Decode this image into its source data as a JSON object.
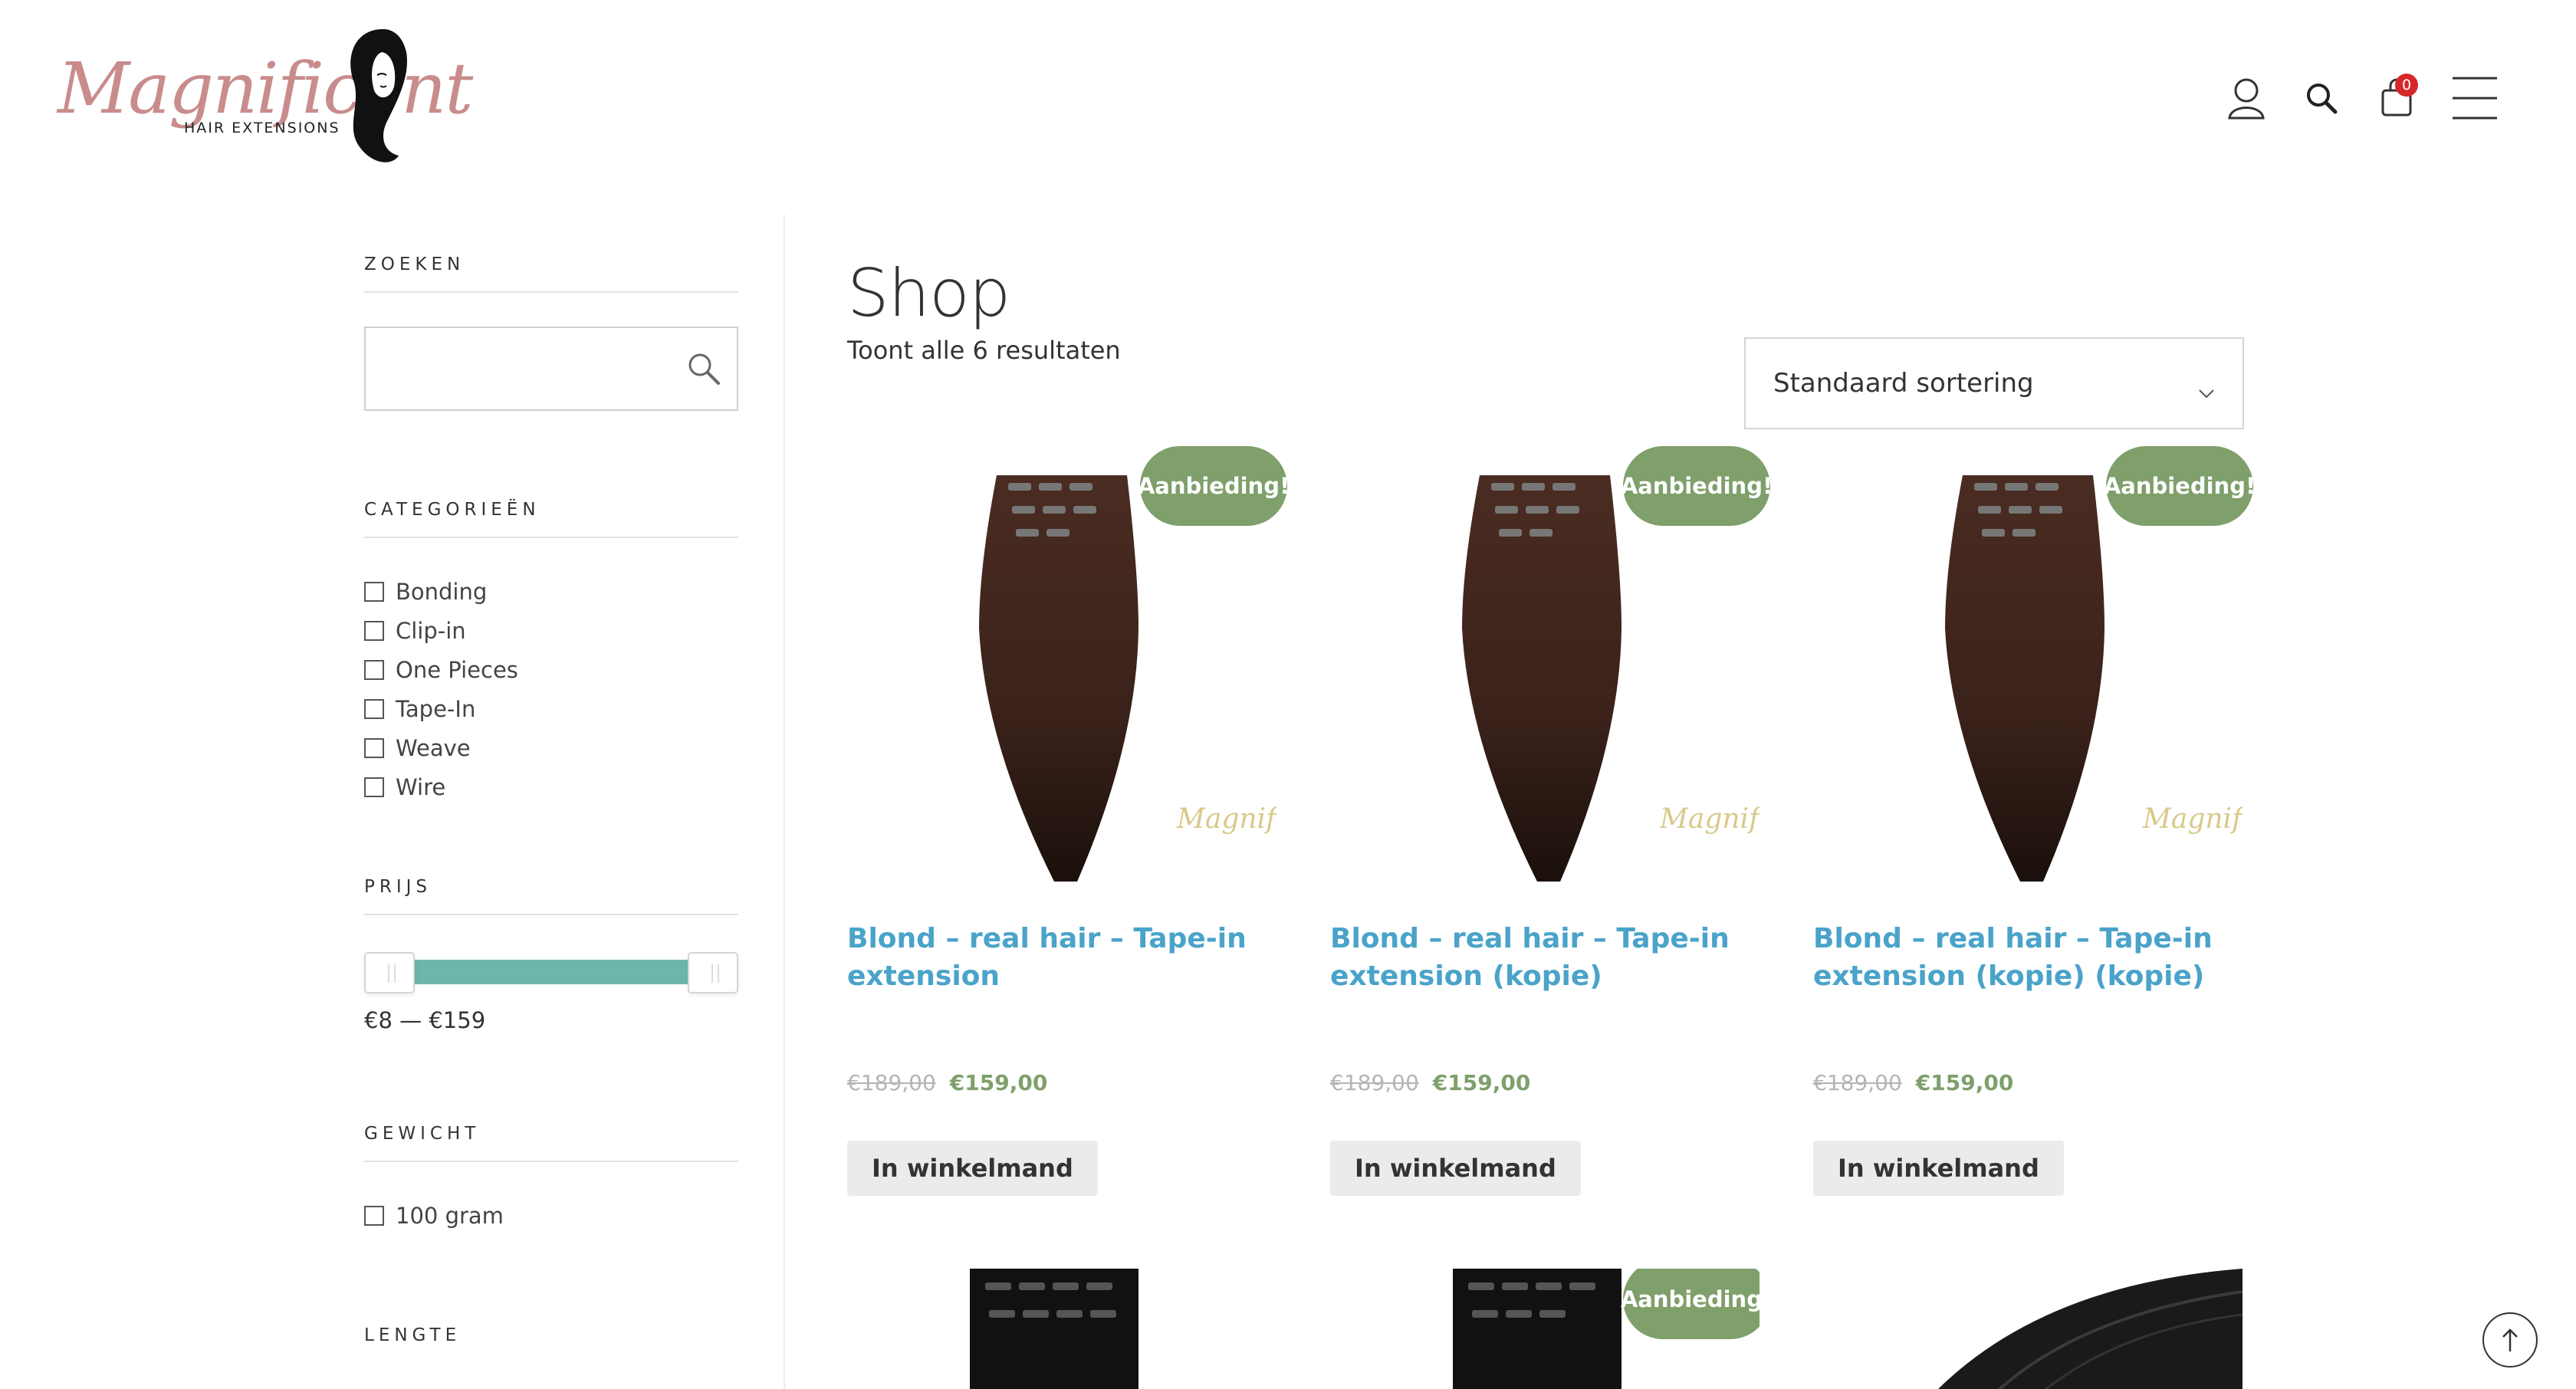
{
  "brand": {
    "logo_script": "Magnificent",
    "logo_sub": "HAIR EXTENSIONS"
  },
  "header": {
    "icons": [
      "user-icon",
      "search-icon",
      "cart-icon",
      "menu-icon"
    ],
    "cart_count": "0"
  },
  "sidebar": {
    "search": {
      "title": "ZOEKEN",
      "placeholder": "",
      "value": ""
    },
    "categories": {
      "title": "CATEGORIEËN",
      "items": [
        "Bonding",
        "Clip-in",
        "One Pieces",
        "Tape-In",
        "Weave",
        "Wire"
      ]
    },
    "price": {
      "title": "PRIJS",
      "label": "€8 — €159",
      "min": 8,
      "max": 159,
      "selected_min_fraction": 0.0,
      "selected_max_fraction": 1.0
    },
    "weight": {
      "title": "GEWICHT",
      "items": [
        "100 gram"
      ]
    },
    "length": {
      "title": "LENGTE"
    }
  },
  "main": {
    "title": "Shop",
    "result_count": "Toont alle 6 resultaten",
    "sort": {
      "selected": "Standaard sortering"
    },
    "products": [
      {
        "title": "Blond – real hair – Tape-in extension",
        "badge": "Aanbieding!",
        "old_price": "€189,00",
        "new_price": "€159,00",
        "button": "In winkelmand"
      },
      {
        "title": "Blond – real hair – Tape-in extension (kopie)",
        "badge": "Aanbieding!",
        "old_price": "€189,00",
        "new_price": "€159,00",
        "button": "In winkelmand"
      },
      {
        "title": "Blond – real hair – Tape-in extension (kopie) (kopie)",
        "badge": "Aanbieding!",
        "old_price": "€189,00",
        "new_price": "€159,00",
        "button": "In winkelmand"
      }
    ],
    "second_row_badge": "Aanbieding!"
  },
  "colors": {
    "accent_link": "#4aa3c9",
    "sale_badge": "#7f9f6b",
    "slider_range": "#6db6ab",
    "cart_badge": "#d62828"
  }
}
